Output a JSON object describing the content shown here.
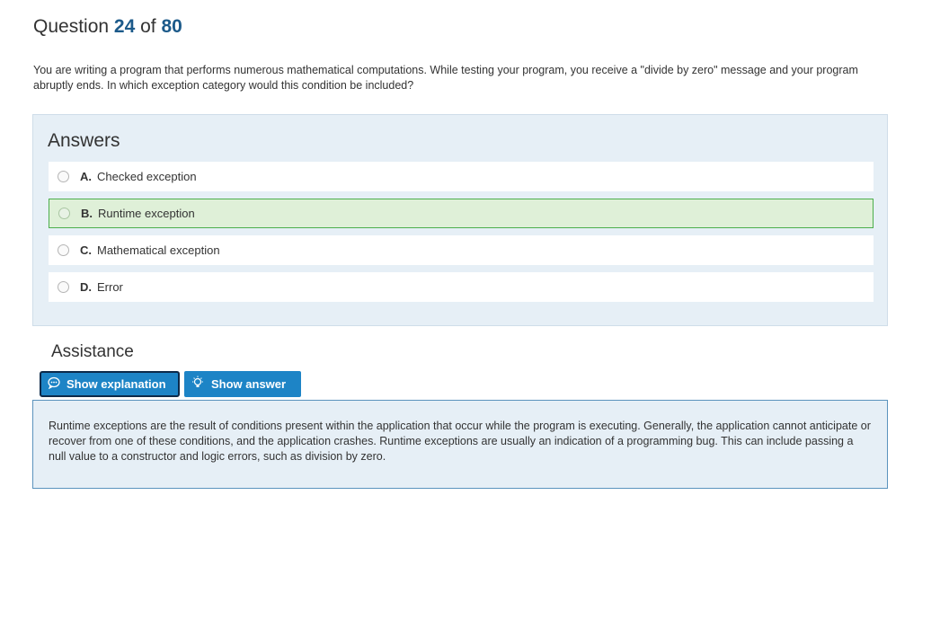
{
  "question": {
    "prefix": "Question",
    "current": "24",
    "of_label": "of",
    "total": "80",
    "text": "You are writing a program that performs numerous mathematical computations. While testing your program, you receive a \"divide by zero\" message and your program abruptly ends. In which exception category would this condition be included?"
  },
  "answers": {
    "title": "Answers",
    "options": [
      {
        "letter": "A.",
        "text": "Checked exception",
        "correct": false
      },
      {
        "letter": "B.",
        "text": "Runtime exception",
        "correct": true
      },
      {
        "letter": "C.",
        "text": "Mathematical exception",
        "correct": false
      },
      {
        "letter": "D.",
        "text": "Error",
        "correct": false
      }
    ]
  },
  "assistance": {
    "title": "Assistance",
    "show_explanation_label": "Show explanation",
    "show_answer_label": "Show answer",
    "explanation": "Runtime exceptions are the result of conditions present within the application that occur while the program is executing. Generally, the application cannot anticipate or recover from one of these conditions, and the application crashes. Runtime exceptions are usually an indication of a programming bug. This can include passing a null value to a constructor and logic errors, such as division by zero."
  },
  "icons": {
    "explanation": "speech-bubble-icon",
    "answer": "lightbulb-icon"
  },
  "colors": {
    "accent": "#1d84c6",
    "question_number": "#1c5a8a",
    "correct_bg": "#dff0d8",
    "correct_border": "#4cae4c",
    "panel_bg": "#e6eff6"
  }
}
